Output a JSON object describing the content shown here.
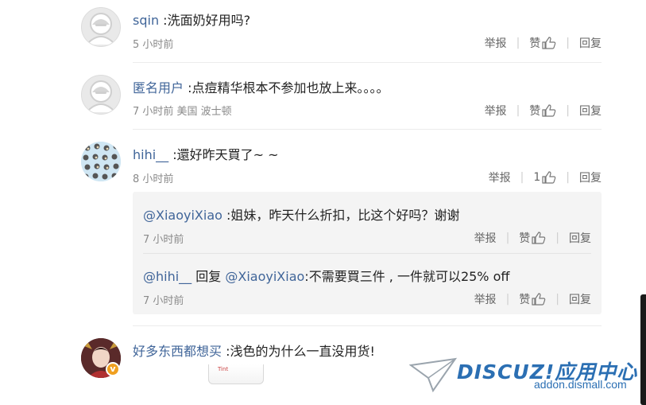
{
  "comments": [
    {
      "author": "sqin",
      "text": ":洗面奶好用吗?",
      "time": "5 小时前",
      "report": "举报",
      "like": "赞",
      "reply": "回复"
    },
    {
      "author": "匿名用户",
      "text": ":点痘精华根本不参加也放上来。。。。",
      "time": "7 小时前 美国 波士顿",
      "report": "举报",
      "like": "赞",
      "reply": "回复"
    },
    {
      "author": "hihi__",
      "text": ":還好昨天買了~ ~",
      "time": "8 小时前",
      "report": "举报",
      "like": "1",
      "reply": "回复",
      "replies": [
        {
          "author": "@XiaoyiXiao",
          "text": ":姐妹，昨天什么折扣，比这个好吗？谢谢",
          "time": "7 小时前",
          "report": "举报",
          "like": "赞",
          "reply": "回复"
        },
        {
          "author": "@hihi__",
          "reply_word": "回复",
          "mention": "@XiaoyiXiao",
          "text": ":不需要買三件 , 一件就可以25% off",
          "time": "7 小时前",
          "report": "举报",
          "like": "赞",
          "reply": "回复"
        }
      ]
    },
    {
      "author": "好多东西都想买",
      "text": ":浅色的为什么一直没用货!"
    }
  ],
  "watermark": {
    "brand": "DISCUZ!应用中心",
    "url": "addon.dismall.com"
  },
  "product_label": "Tint",
  "colors": {
    "author": "#406599",
    "watermark": "#2b6fb3",
    "reply_bg": "#f4f4f4"
  }
}
